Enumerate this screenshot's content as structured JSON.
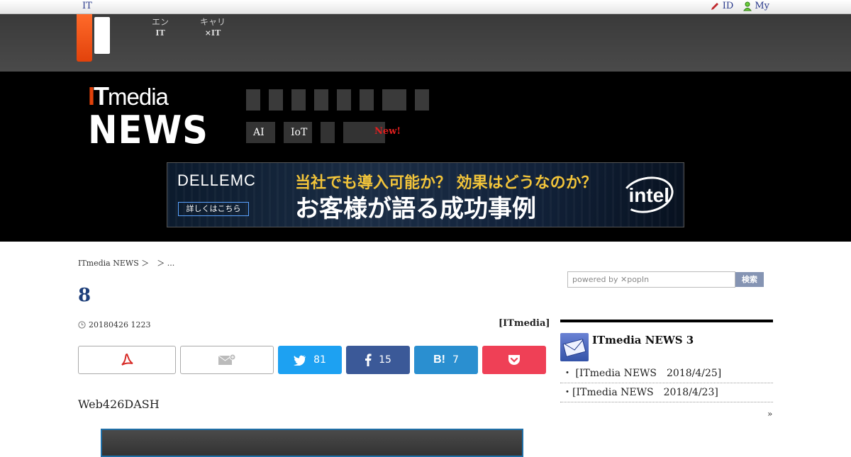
{
  "topbar": {
    "it_link": "IT",
    "id_label": "ID",
    "my_label": "My"
  },
  "header": {
    "services": [
      {
        "label": "エン",
        "sub": "IT"
      },
      {
        "label": "キャリ",
        "sub": "×IT"
      }
    ],
    "brand_top": "ITmedia",
    "brand_bottom": "NEWS",
    "subnav": [
      "AI",
      "IoT",
      "",
      ""
    ],
    "new_badge": "New!"
  },
  "banner": {
    "brand": "DELLEMC",
    "detail_button": "詳しくはこちら",
    "line1": "当社でも導入可能か？ 効果はどうなのか？",
    "line2": "お客様が語る成功事例",
    "partner": "intel"
  },
  "article": {
    "breadcrumb": "ITmedia NEWS ＞　＞ ...",
    "title": "8",
    "date": "20180426 1223",
    "byline": "[ITmedia]",
    "share": {
      "twitter_count": "81",
      "facebook_count": "15",
      "hatena_count": "7"
    },
    "lead": "Web426DASH"
  },
  "sidebar": {
    "search_placeholder": "powered by ✕popIn",
    "search_button": "検索",
    "box_title": "ITmedia NEWS 3",
    "items": [
      "・ [ITmedia NEWS　2018/4/25]",
      "・[ITmedia NEWS　2018/4/23]"
    ],
    "more": "»"
  },
  "colors": {
    "accent": "#e2420b",
    "title_blue": "#1e3f7a",
    "twitter": "#1da1f2",
    "facebook": "#3b5998",
    "hatena": "#2a8fd0",
    "pocket": "#ef4056"
  }
}
